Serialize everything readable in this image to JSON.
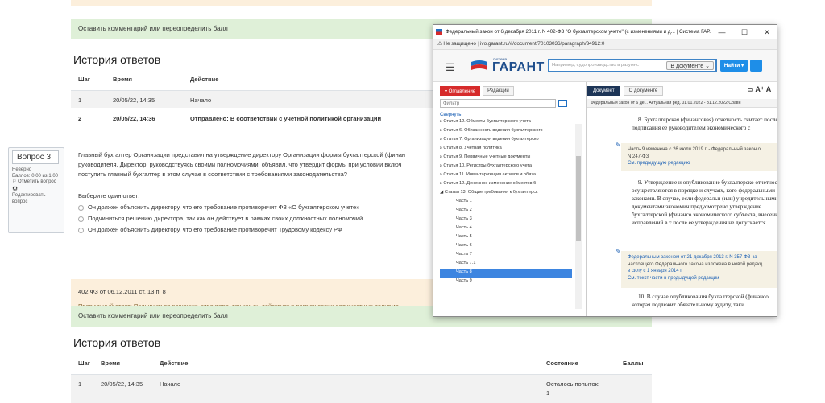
{
  "moodle": {
    "comment_bar_1": "Оставить комментарий или переопределить балл",
    "history_title_1": "История ответов",
    "history1": {
      "headers": [
        "Шаг",
        "Время",
        "Действие"
      ],
      "rows": [
        [
          "1",
          "20/05/22, 14:35",
          "Начало"
        ],
        [
          "2",
          "20/05/22, 14:36",
          "Отправлено: В соответствии с учетной политикой организации"
        ]
      ]
    },
    "question": {
      "number": "Вопрос 3",
      "status": "Неверно",
      "score": "Баллов: 0,00 из 1,00",
      "flag": "Отметить вопрос",
      "edit": "Редактировать вопрос",
      "text_line1": "Главный бухгалтер Организации представил на утверждение директору Организации формы бухгалтерской (финан",
      "text_line2": "руководителя. Директор, руководствуясь своими полномочиями, объявил, что утвердит формы при условии включ",
      "text_line3": "поступить главный бухгалтер в этом случае в соответствии с требованиями законодательства?",
      "prompt": "Выберите один ответ:",
      "options": [
        "Он должен объяснить директору, что его требование противоречит ФЗ «О бухгалтерском учете»",
        "Подчиниться решению директора, так как он действует в рамках своих должностных полномочий",
        "Он должен объяснить директору, что его требование противоречит Трудовому кодексу РФ"
      ]
    },
    "feedback": {
      "line1": "402 ФЗ от 06.12.2011 ст. 13 п. 8",
      "line2": "Правильный ответ: Подчиниться решению директора, так как он действует в рамках своих должностных полномо"
    },
    "comment_bar_2": "Оставить комментарий или переопределить балл",
    "history_title_2": "История ответов",
    "history2": {
      "headers": [
        "Шаг",
        "Время",
        "Действие",
        "Состояние",
        "Баллы"
      ],
      "rows": [
        [
          "1",
          "20/05/22, 14:35",
          "Начало",
          "Осталось попыток:",
          "1"
        ]
      ]
    }
  },
  "popup": {
    "title": "Федеральный закон от 6 декабря 2011 г. N 402-ФЗ \"О бухгалтерском учете\" (с изменениями и д... | Система ГАР...",
    "controls": [
      "—",
      "☐",
      "✕"
    ],
    "insecure": "Не защищено",
    "url": "ivo.garant.ru/#/document/70103036/paragraph/34912:0",
    "logo_small": "система",
    "logo": "ГАРАНТ",
    "search_placeholder": "Например, судопроизводство в разумнс",
    "search_scope": "В документе",
    "find_button": "Найти",
    "left_tabs": [
      "▾ Оглавление",
      "Редакции"
    ],
    "filter_placeholder": "Фильтр",
    "collapse": "Свернуть",
    "toc": [
      "Статья 12. Объекты бухгалтерского учета",
      "Статья 6. Обязанность ведения бухгалтерского",
      "Статья 7. Организация ведения бухгалтерско",
      "Статья 8. Учетная политика",
      "Статья 9. Первичные учетные документы",
      "Статья 10. Регистры бухгалтерского учета",
      "Статья 11. Инвентаризация активов и обяза",
      "Статья 12. Денежное измерение объектов б",
      "Статья 13. Общие требования к бухгалтерск",
      "Часть 1",
      "Часть 2",
      "Часть 3",
      "Часть 4",
      "Часть 5",
      "Часть 6",
      "Часть 7",
      "Часть 7.1",
      "Часть 8",
      "Часть 9"
    ],
    "right_tabs": [
      "Документ",
      "О документе"
    ],
    "toolbar_icons": "A⁺ A⁻",
    "doc_subbar": "Федеральный закон от 6 де...   Актуальная ред. 01.01.2022 - 31.12.2022  Сравн",
    "doc": {
      "p8": "8. Бухгалтерская (финансовая) отчетность считает после подписания ее руководителем экономического с",
      "note1_l1": "Часть 9 изменена с 26 июля 2019 г. - Федеральный закон о",
      "note1_l2": "N 247-ФЗ",
      "note1_l3": "См. предыдущую редакцию",
      "p9": "9. Утверждение и опубликование бухгалтерско отчетности осуществляются в порядке и случаях, кото федеральными законами. В случае, если федеральн (или) учредительными документами экономич предусмотрено утверждение бухгалтерской (финансо экономического субъекта, внесение исправлений в т после ее утверждения не допускается.",
      "note2_l1": "Федеральным законом от 21 декабря 2013 г. N 357-ФЗ ча",
      "note2_l2": "настоящего Федерального закона изложена в новой редакц",
      "note2_l3": "в силу с 1 января 2014 г.",
      "note2_l4": "См. текст части в предыдущей редакции",
      "p10": "10. В случае опубликования бухгалтерской (финансо которая подлежит обязательному аудиту, таки"
    }
  }
}
